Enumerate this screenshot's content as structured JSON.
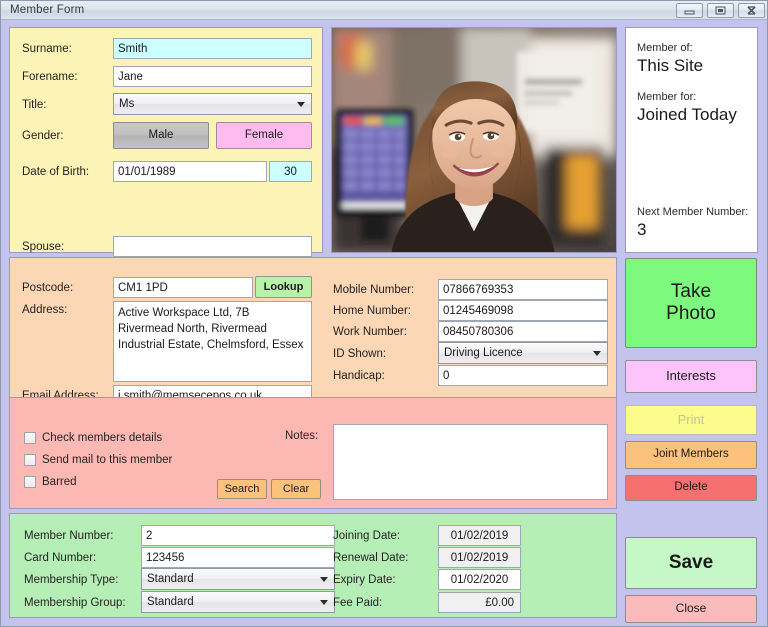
{
  "window": {
    "title": "Member Form",
    "buttons": {
      "minimize": "minimize-icon",
      "restore": "restore-icon",
      "close": "close-icon"
    }
  },
  "personal": {
    "surname": {
      "label": "Surname:",
      "value": "Smith"
    },
    "forename": {
      "label": "Forename:",
      "value": "Jane"
    },
    "title": {
      "label": "Title:",
      "value": "Ms"
    },
    "gender": {
      "label": "Gender:",
      "male": "Male",
      "female": "Female"
    },
    "dob": {
      "label": "Date of Birth:",
      "value": "01/01/1989",
      "age": "30"
    },
    "spouse": {
      "label": "Spouse:",
      "value": ""
    }
  },
  "photo": {
    "alt": "member-photo"
  },
  "info": {
    "member_of_label": "Member of:",
    "member_of_value": "This Site",
    "member_for_label": "Member for:",
    "member_for_value": "Joined Today",
    "next_number_label": "Next Member Number:",
    "next_number_value": "3"
  },
  "contact": {
    "postcode": {
      "label": "Postcode:",
      "value": "CM1 1PD"
    },
    "lookup_label": "Lookup",
    "address": {
      "label": "Address:",
      "value": "Active Workspace Ltd, 7B Rivermead North, Rivermead Industrial Estate, Chelmsford, Essex"
    },
    "email": {
      "label": "Email Address:",
      "value": "j.smith@memsecepos.co.uk"
    },
    "mobile": {
      "label": "Mobile Number:",
      "value": "07866769353"
    },
    "home": {
      "label": "Home Number:",
      "value": "01245469098"
    },
    "work": {
      "label": "Work Number:",
      "value": "08450780306"
    },
    "id_shown": {
      "label": "ID Shown:",
      "value": "Driving Licence"
    },
    "handicap": {
      "label": "Handicap:",
      "value": "0"
    }
  },
  "flags": {
    "check_details": "Check members details",
    "send_mail": "Send mail to this member",
    "barred": "Barred",
    "search_label": "Search",
    "clear_label": "Clear",
    "notes_label": "Notes:",
    "notes_value": ""
  },
  "membership": {
    "member_number": {
      "label": "Member Number:",
      "value": "2"
    },
    "card_number": {
      "label": "Card Number:",
      "value": "123456"
    },
    "type": {
      "label": "Membership Type:",
      "value": "Standard"
    },
    "group": {
      "label": "Membership Group:",
      "value": "Standard"
    },
    "joining_date": {
      "label": "Joining Date:",
      "value": "01/02/2019"
    },
    "renewal_date": {
      "label": "Renewal Date:",
      "value": "01/02/2019"
    },
    "expiry_date": {
      "label": "Expiry Date:",
      "value": "01/02/2020"
    },
    "fee_paid": {
      "label": "Fee Paid:",
      "value": "£0.00"
    }
  },
  "actions": {
    "take_photo": "Take Photo",
    "take_photo_line1": "Take",
    "take_photo_line2": "Photo",
    "interests": "Interests",
    "print": "Print",
    "joint_members": "Joint Members",
    "delete": "Delete",
    "save": "Save",
    "close": "Close"
  },
  "colors": {
    "frame": "#c3c3ee",
    "personal_panel": "#fbf4b6",
    "contact_panel": "#fbd7b5",
    "flags_panel": "#fcb9b3",
    "membership_panel": "#b5efb5",
    "take_photo": "#7dfa7d",
    "interests": "#fdc3fb",
    "print": "#fcfc8c",
    "joint_members": "#fcc27d",
    "delete": "#f77070",
    "save": "#c6f7c6",
    "close": "#fcbbbb",
    "lookup": "#b7f2a8",
    "female": "#ffbbee",
    "highlight_field": "#ccffff"
  }
}
